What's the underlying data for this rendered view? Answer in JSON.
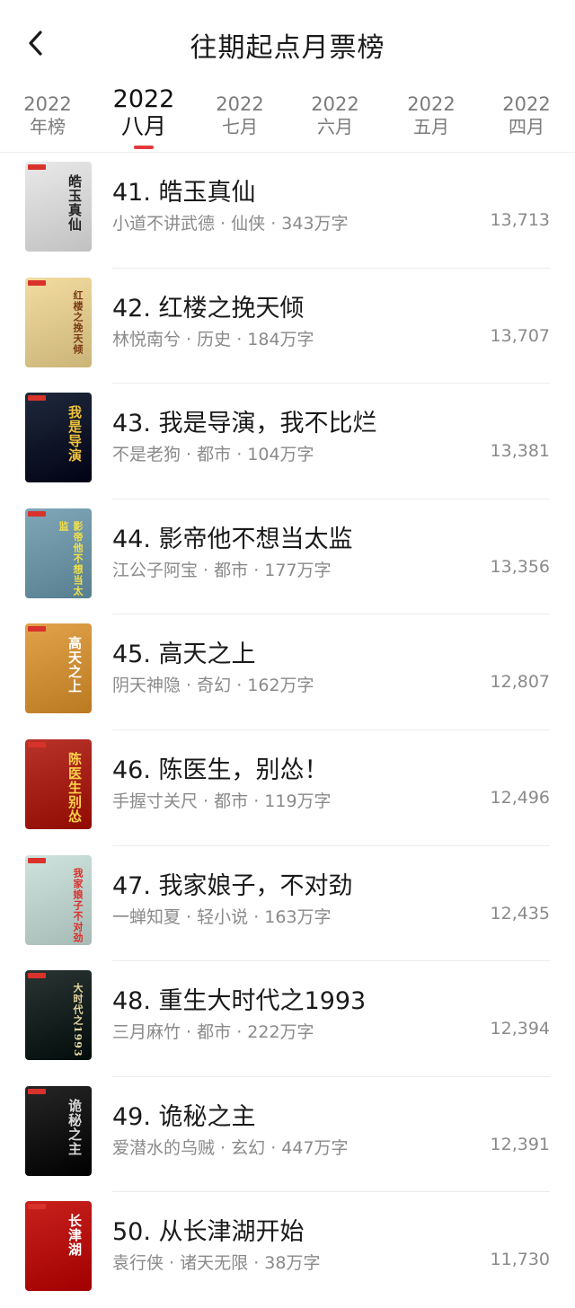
{
  "header": {
    "title": "往期起点月票榜"
  },
  "tabs": [
    {
      "year": "2022",
      "label": "年榜",
      "active": false
    },
    {
      "year": "2022",
      "label": "八月",
      "active": true
    },
    {
      "year": "2022",
      "label": "七月",
      "active": false
    },
    {
      "year": "2022",
      "label": "六月",
      "active": false
    },
    {
      "year": "2022",
      "label": "五月",
      "active": false
    },
    {
      "year": "2022",
      "label": "四月",
      "active": false
    }
  ],
  "books": [
    {
      "title": "41. 皓玉真仙",
      "author": "小道不讲武德",
      "genre": "仙侠",
      "words": "343万字",
      "votes": "13,713"
    },
    {
      "title": "42. 红楼之挽天倾",
      "author": "林悦南兮",
      "genre": "历史",
      "words": "184万字",
      "votes": "13,707"
    },
    {
      "title": "43. 我是导演，我不比烂",
      "author": "不是老狗",
      "genre": "都市",
      "words": "104万字",
      "votes": "13,381"
    },
    {
      "title": "44. 影帝他不想当太监",
      "author": "江公子阿宝",
      "genre": "都市",
      "words": "177万字",
      "votes": "13,356"
    },
    {
      "title": "45. 高天之上",
      "author": "阴天神隐",
      "genre": "奇幻",
      "words": "162万字",
      "votes": "12,807"
    },
    {
      "title": "46. 陈医生，别怂！",
      "author": "手握寸关尺",
      "genre": "都市",
      "words": "119万字",
      "votes": "12,496"
    },
    {
      "title": "47. 我家娘子，不对劲",
      "author": "一蝉知夏",
      "genre": "轻小说",
      "words": "163万字",
      "votes": "12,435"
    },
    {
      "title": "48. 重生大时代之1993",
      "author": "三月麻竹",
      "genre": "都市",
      "words": "222万字",
      "votes": "12,394"
    },
    {
      "title": "49. 诡秘之主",
      "author": "爱潜水的乌贼",
      "genre": "玄幻",
      "words": "447万字",
      "votes": "12,391"
    },
    {
      "title": "50. 从长津湖开始",
      "author": "袁行侠",
      "genre": "诸天无限",
      "words": "38万字",
      "votes": "11,730"
    }
  ],
  "covers": [
    {
      "text": "皓玉真仙",
      "bg": "#e9e9ea",
      "fg": "#222222"
    },
    {
      "text": "红楼之挽天倾",
      "bg": "#f3dca0",
      "fg": "#7a3b14"
    },
    {
      "text": "我是导演",
      "bg": "#1f2a3c",
      "fg": "#f0c23c"
    },
    {
      "text": "影帝他不想当太监",
      "bg": "#7fa7b8",
      "fg": "#f4e04a"
    },
    {
      "text": "高天之上",
      "bg": "#e2a24a",
      "fg": "#ffffff"
    },
    {
      "text": "陈医生别怂",
      "bg": "#b8332a",
      "fg": "#ffd34a"
    },
    {
      "text": "我家娘子不对劲",
      "bg": "#cfe3de",
      "fg": "#d8302a"
    },
    {
      "text": "大时代之1993",
      "bg": "#2a3433",
      "fg": "#e6d6a0"
    },
    {
      "text": "诡秘之主",
      "bg": "#262626",
      "fg": "#d8d8d8"
    },
    {
      "text": "长津湖",
      "bg": "#c8211d",
      "fg": "#ffffff"
    }
  ],
  "colors": {
    "accent": "#e4393c",
    "text_primary": "#1a1a1a",
    "text_secondary": "#8a8a8a"
  },
  "icons": {
    "back": "chevron-left-icon"
  }
}
